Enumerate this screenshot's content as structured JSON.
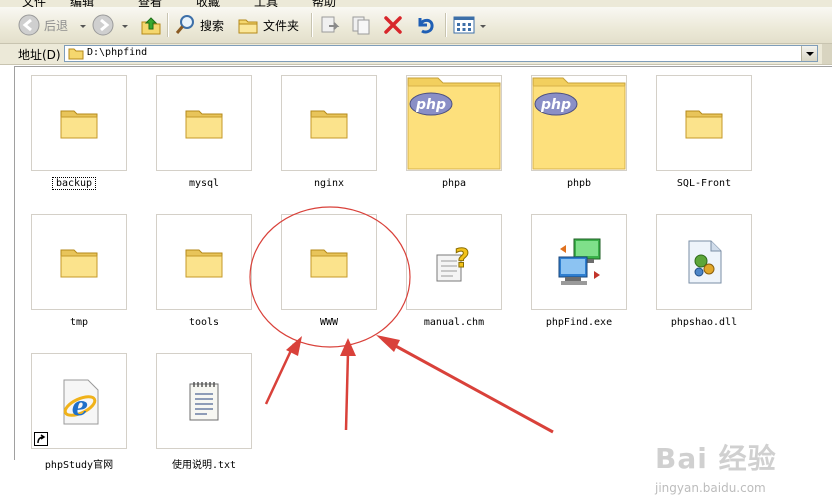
{
  "menubar": {
    "items": [
      "文件",
      "编辑",
      "查看",
      "收藏",
      "工具",
      "帮助"
    ]
  },
  "toolbar": {
    "back_label": "后退",
    "search_label": "搜索",
    "folders_label": "文件夹"
  },
  "address": {
    "label": "地址(D)",
    "value": "D:\\phpfind"
  },
  "items": [
    {
      "name": "backup",
      "icon": "folder-icon"
    },
    {
      "name": "mysql",
      "icon": "folder-icon"
    },
    {
      "name": "nginx",
      "icon": "folder-icon"
    },
    {
      "name": "phpa",
      "icon": "php-folder-icon"
    },
    {
      "name": "phpb",
      "icon": "php-folder-icon"
    },
    {
      "name": "SQL-Front",
      "icon": "folder-icon"
    },
    {
      "name": "tmp",
      "icon": "folder-icon"
    },
    {
      "name": "tools",
      "icon": "folder-icon"
    },
    {
      "name": "WWW",
      "icon": "folder-icon"
    },
    {
      "name": "manual.chm",
      "icon": "help-file-icon"
    },
    {
      "name": "phpFind.exe",
      "icon": "network-computers-icon"
    },
    {
      "name": "phpshao.dll",
      "icon": "dll-file-icon"
    },
    {
      "name": "phpStudy官网",
      "icon": "ie-shortcut-icon"
    },
    {
      "name": "使用说明.txt",
      "icon": "text-file-icon"
    }
  ],
  "annotation": {
    "color": "#d9413a"
  },
  "watermark": {
    "main": "Bai 经验",
    "sub": "jingyan.baidu.com"
  }
}
